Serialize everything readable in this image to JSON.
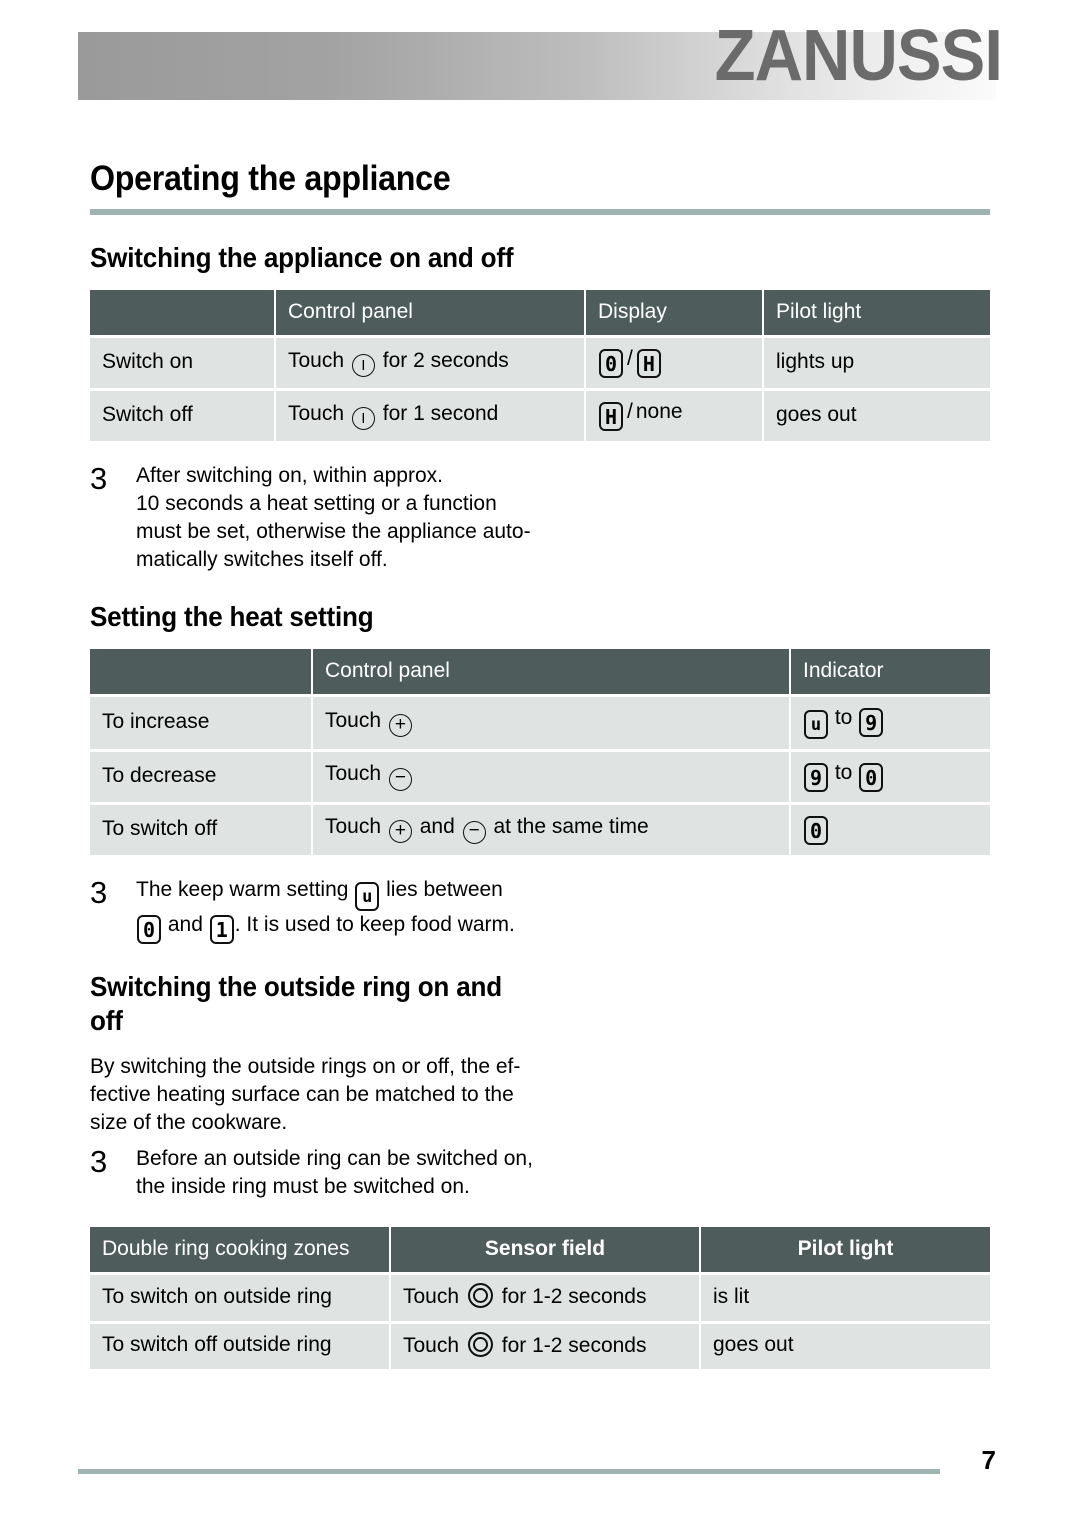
{
  "header": {
    "brand": "ZANUSSI"
  },
  "chapter": {
    "title": "Operating the appliance"
  },
  "sections": {
    "switching_on_off": {
      "heading": "Switching the appliance on and off"
    },
    "heat_setting": {
      "heading": "Setting the heat setting"
    },
    "outside_ring": {
      "heading": "Switching the outside ring on and off",
      "paragraph_lines": [
        "By switching the outside rings on or off, the ef-",
        "fective heating surface can be matched to the",
        "size of the cookware."
      ]
    }
  },
  "table_on_off": {
    "headers": [
      "",
      "Control panel",
      "Display",
      "Pilot light"
    ],
    "rows": [
      {
        "action": "Switch on",
        "control_prefix": "Touch",
        "control_icon": "power-circle-icon",
        "control_suffix": "for 2 seconds",
        "display_first": "0",
        "display_sep": "/",
        "display_second": "H",
        "pilot": "lights up"
      },
      {
        "action": "Switch off",
        "control_prefix": "Touch",
        "control_icon": "power-circle-icon",
        "control_suffix": "for 1 second",
        "display_first": "H",
        "display_sep": "/",
        "display_second": "none",
        "pilot": "goes out"
      }
    ]
  },
  "note_auto_off": {
    "icon": "3",
    "lines": [
      "After switching on, within approx.",
      "10 seconds a heat setting or a function",
      "must be set, otherwise the appliance auto-",
      "matically switches itself off."
    ]
  },
  "table_heat_setting": {
    "headers": [
      "",
      "Control panel",
      "Indicator"
    ],
    "rows": [
      {
        "action": "To increase",
        "control_prefix": "Touch",
        "control_icon": "plus-circle-icon",
        "control_mid": "",
        "control_icon2": "",
        "control_suffix": "",
        "indicator_first": "u",
        "indicator_word": "to",
        "indicator_second": "9"
      },
      {
        "action": "To decrease",
        "control_prefix": "Touch",
        "control_icon": "minus-circle-icon",
        "control_mid": "",
        "control_icon2": "",
        "control_suffix": "",
        "indicator_first": "9",
        "indicator_word": "to",
        "indicator_second": "0"
      },
      {
        "action": "To switch off",
        "control_prefix": "Touch",
        "control_icon": "plus-circle-icon",
        "control_mid": "and",
        "control_icon2": "minus-circle-icon",
        "control_suffix": "at the same time",
        "indicator_first": "0",
        "indicator_word": "",
        "indicator_second": ""
      }
    ]
  },
  "note_keep_warm": {
    "icon": "3",
    "line1_a": "The keep warm setting",
    "line1_seg": "u",
    "line1_b": "lies between",
    "line2_seg1": "0",
    "line2_mid": "and",
    "line2_seg2": "1",
    "line2_b": ". It is used to keep food warm."
  },
  "note_inside_ring": {
    "icon": "3",
    "lines": [
      "Before an outside ring can be switched on,",
      "the inside ring must be switched on."
    ]
  },
  "table_double_ring": {
    "headers": [
      "Double ring cooking zones",
      "Sensor field",
      "Pilot light"
    ],
    "rows": [
      {
        "action": "To switch on outside ring",
        "sensor_prefix": "Touch",
        "sensor_icon": "double-ring-icon",
        "sensor_suffix": "for 1-2 seconds",
        "pilot": "is lit"
      },
      {
        "action": "To switch off outside ring",
        "sensor_prefix": "Touch",
        "sensor_icon": "double-ring-icon",
        "sensor_suffix": "for 1-2 seconds",
        "pilot": "goes out"
      }
    ]
  },
  "footer": {
    "page_number": "7"
  },
  "colors": {
    "rule": "#9fb3b1",
    "table_header_bg": "#4e5d5b",
    "table_row_bg": "#dfe4e3",
    "brand": "#6b6b6b"
  }
}
